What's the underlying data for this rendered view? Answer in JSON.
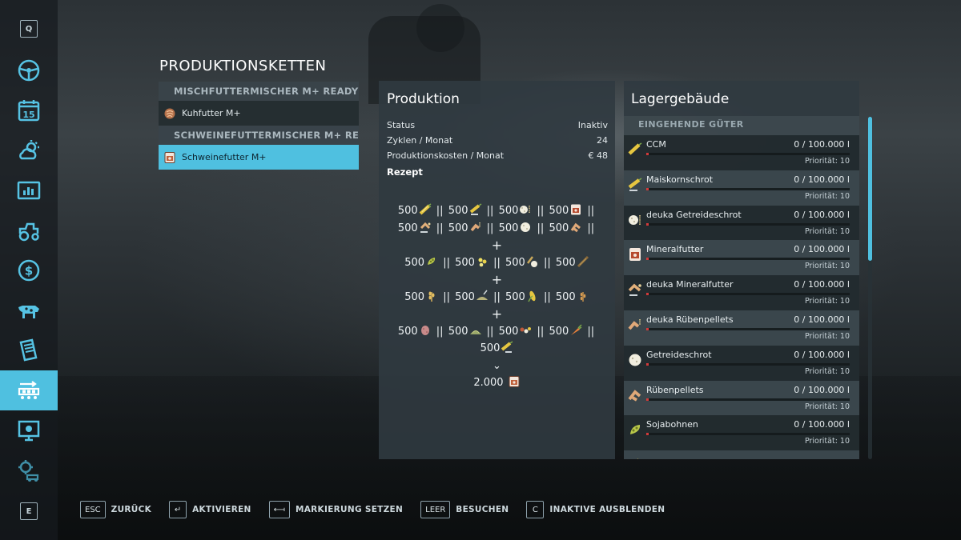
{
  "sidebar": {
    "top_key": "Q",
    "bottom_key": "E",
    "items": [
      {
        "icon": "steering-wheel-icon",
        "active": false
      },
      {
        "icon": "calendar-icon",
        "label": "15",
        "active": false
      },
      {
        "icon": "weather-icon",
        "active": false
      },
      {
        "icon": "statistics-icon",
        "active": false
      },
      {
        "icon": "tractor-icon",
        "active": false
      },
      {
        "icon": "finances-icon",
        "active": false
      },
      {
        "icon": "animals-icon",
        "active": false
      },
      {
        "icon": "contracts-icon",
        "active": false
      },
      {
        "icon": "production-icon",
        "active": true
      },
      {
        "icon": "help-icon",
        "active": false
      },
      {
        "icon": "settings-icon",
        "active": false
      }
    ]
  },
  "title": "PRODUKTIONSKETTEN",
  "chains": [
    {
      "group": "MISCHFUTTERMISCHER M+ READY   - II",
      "items": [
        {
          "label": "Kuhfutter M+",
          "icon": "cow-feed-icon"
        }
      ]
    },
    {
      "group": "SCHWEINEFUTTERMISCHER M+ READY .",
      "items": [
        {
          "label": "Schweinefutter M+",
          "icon": "pig-feed-icon",
          "selected": true
        }
      ]
    }
  ],
  "production": {
    "title": "Produktion",
    "rows": [
      {
        "label": "Status",
        "value": "Inaktiv"
      },
      {
        "label": "Zyklen / Monat",
        "value": "24"
      },
      {
        "label": "Produktionskosten / Monat",
        "value": "€ 48"
      }
    ],
    "recipe_label": "Rezept",
    "plus": "+",
    "arrow": "⌄",
    "output_amount": "2.000",
    "recipe_amount": "500"
  },
  "storage": {
    "title": "Lagergebäude",
    "section": "EINGEHENDE GÜTER",
    "goods": [
      {
        "name": "CCM",
        "amount": "0  / 100.000 l",
        "priority": "Priorität: 10",
        "icon": "ccm-icon"
      },
      {
        "name": "Maiskornschrot",
        "amount": "0  / 100.000 l",
        "priority": "Priorität: 10",
        "icon": "corn-meal-icon"
      },
      {
        "name": "deuka Getreideschrot",
        "amount": "0  / 100.000 l",
        "priority": "Priorität: 10",
        "icon": "grain-meal-icon"
      },
      {
        "name": "Mineralfutter",
        "amount": "0  / 100.000 l",
        "priority": "Priorität: 10",
        "icon": "mineral-feed-icon"
      },
      {
        "name": "deuka Mineralfutter",
        "amount": "0  / 100.000 l",
        "priority": "Priorität: 10",
        "icon": "deuka-mineral-feed-icon"
      },
      {
        "name": "deuka Rübenpellets",
        "amount": "0  / 100.000 l",
        "priority": "Priorität: 10",
        "icon": "beet-pellets-icon"
      },
      {
        "name": "Getreideschrot",
        "amount": "0  / 100.000 l",
        "priority": "Priorität: 10",
        "icon": "grain-meal-icon"
      },
      {
        "name": "Rübenpellets",
        "amount": "0  / 100.000 l",
        "priority": "Priorität: 10",
        "icon": "beet-pellets-icon"
      },
      {
        "name": "Sojabohnen",
        "amount": "0  / 100.000 l",
        "priority": "Priorität: 10",
        "icon": "soybean-icon"
      },
      {
        "name": "",
        "amount": "",
        "priority": "",
        "icon": "corn-icon"
      }
    ]
  },
  "footer": [
    {
      "key": "ESC",
      "label": "ZURÜCK"
    },
    {
      "key": "↵",
      "label": "AKTIVIEREN"
    },
    {
      "key": "⟻",
      "label": "MARKIERUNG SETZEN"
    },
    {
      "key": "LEER",
      "label": "BESUCHEN"
    },
    {
      "key": "C",
      "label": "INAKTIVE AUSBLENDEN"
    }
  ],
  "colors": {
    "accent": "#4fc0e0",
    "panel": "#303a40",
    "fill_marker": "#d33a3a"
  }
}
